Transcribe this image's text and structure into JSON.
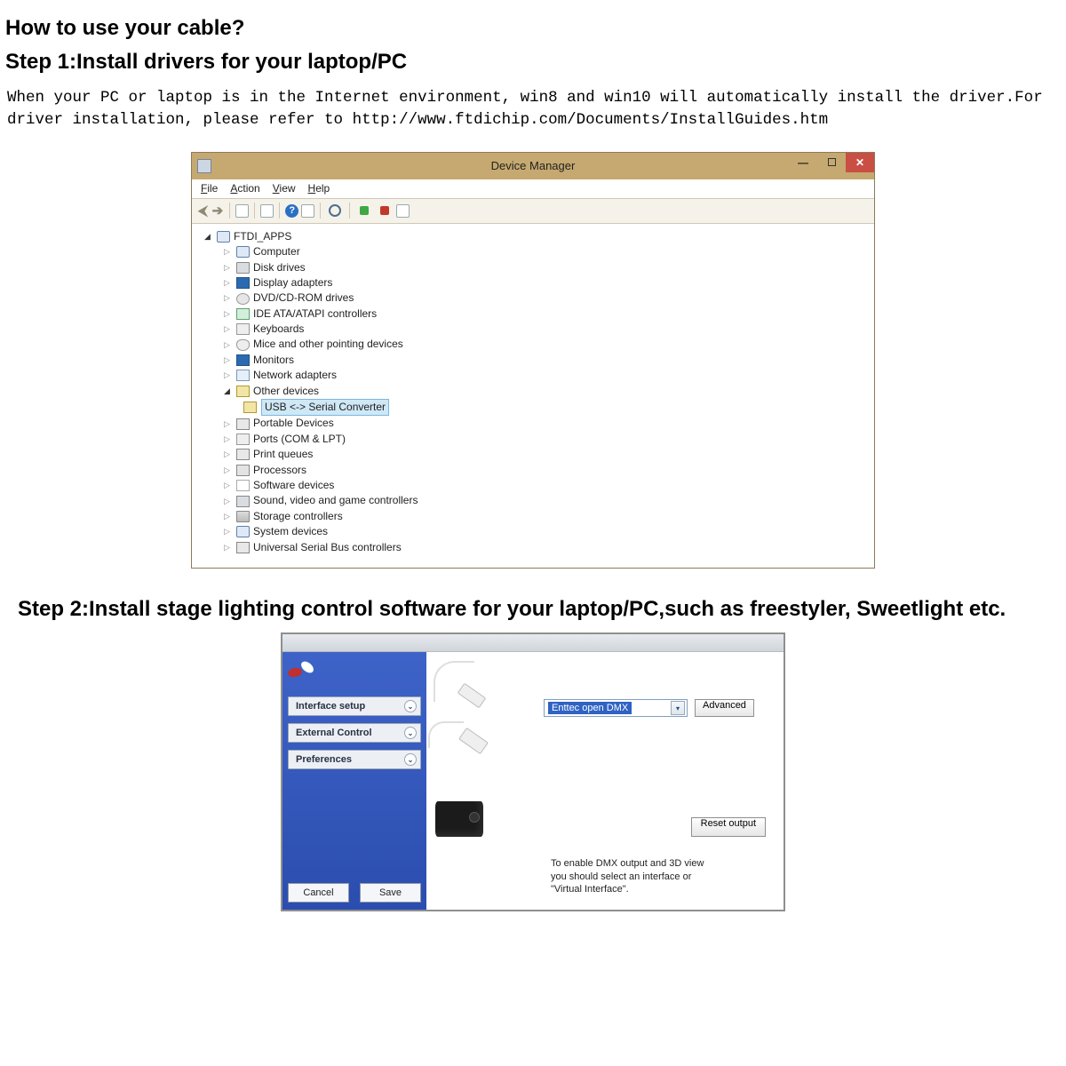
{
  "headings": {
    "title": "How to use your cable?",
    "step1": "Step 1:Install drivers for your laptop/PC",
    "paragraph": "   When your PC or laptop is in the Internet environment, win8 and win10 will automatically install the driver.For driver installation, please refer to http://www.ftdichip.com/Documents/InstallGuides.htm",
    "step2": "Step 2:Install stage lighting control software for your laptop/PC,such as freestyler, Sweetlight etc."
  },
  "dm": {
    "window_title": "Device Manager",
    "menu": {
      "file": "File",
      "action": "Action",
      "view": "View",
      "help": "Help"
    },
    "root": "FTDI_APPS",
    "nodes": {
      "computer": "Computer",
      "disk": "Disk drives",
      "display": "Display adapters",
      "dvd": "DVD/CD-ROM drives",
      "ide": "IDE ATA/ATAPI controllers",
      "keyboards": "Keyboards",
      "mice": "Mice and other pointing devices",
      "monitors": "Monitors",
      "network": "Network adapters",
      "other": "Other devices",
      "usbserial": "USB <-> Serial Converter",
      "portable": "Portable Devices",
      "ports": "Ports (COM & LPT)",
      "print": "Print queues",
      "processors": "Processors",
      "software": "Software devices",
      "sound": "Sound, video and game controllers",
      "storage": "Storage controllers",
      "system": "System devices",
      "usb": "Universal Serial Bus controllers"
    }
  },
  "pref": {
    "side": {
      "interface": "Interface setup",
      "external": "External Control",
      "preferences": "Preferences",
      "cancel": "Cancel",
      "save": "Save"
    },
    "combo_value": "Enttec open DMX",
    "advanced": "Advanced",
    "reset": "Reset output",
    "hint1": "To enable DMX output and 3D view",
    "hint2": "you should select an interface or",
    "hint3": "\"Virtual Interface\"."
  }
}
